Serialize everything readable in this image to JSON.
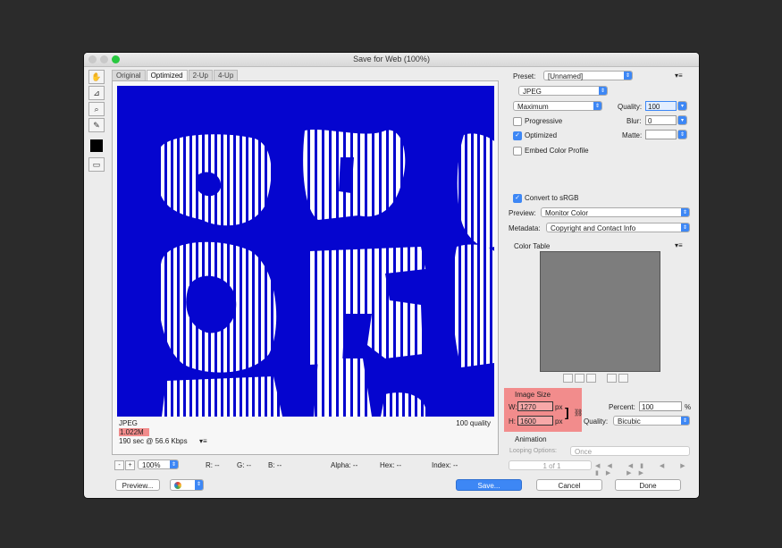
{
  "window": {
    "title": "Save for Web (100%)"
  },
  "tabs": [
    {
      "label": "Original"
    },
    {
      "label": "Optimized"
    },
    {
      "label": "2-Up"
    },
    {
      "label": "4-Up"
    }
  ],
  "tools": {
    "hand": "✋",
    "slice": "⊿",
    "zoom": "⌕",
    "eyedropper": "✎"
  },
  "image_info": {
    "format": "JPEG",
    "size": "1.022M",
    "time": "190 sec @ 56.6 Kbps",
    "quality": "100 quality"
  },
  "statusbar": {
    "zoom": "100%",
    "r": "R: --",
    "g": "G: --",
    "b": "B: --",
    "alpha": "Alpha: --",
    "hex": "Hex: --",
    "index": "Index: --"
  },
  "settings": {
    "preset_label": "Preset:",
    "preset_value": "[Unnamed]",
    "format": "JPEG",
    "compression": "Maximum",
    "quality_label": "Quality:",
    "quality_value": "100",
    "blur_label": "Blur:",
    "blur_value": "0",
    "matte_label": "Matte:",
    "progressive": "Progressive",
    "optimized": "Optimized",
    "embed_profile": "Embed Color Profile",
    "convert_srgb": "Convert to sRGB",
    "preview_label": "Preview:",
    "preview_value": "Monitor Color",
    "metadata_label": "Metadata:",
    "metadata_value": "Copyright and Contact Info",
    "color_table": "Color Table"
  },
  "image_size": {
    "title": "Image Size",
    "w_label": "W:",
    "w_value": "1270",
    "h_label": "H:",
    "h_value": "1600",
    "unit": "px",
    "percent_label": "Percent:",
    "percent_value": "100",
    "percent_unit": "%",
    "quality_label": "Quality:",
    "quality_value": "Bicubic"
  },
  "animation": {
    "title": "Animation",
    "looping_label": "Looping Options:",
    "looping_value": "Once",
    "frame": "1 of 1"
  },
  "buttons": {
    "preview": "Preview...",
    "save": "Save...",
    "cancel": "Cancel",
    "done": "Done"
  },
  "colors": {
    "canvas": "#0505cf",
    "accent": "#3d87f5",
    "highlight": "#f28c8c"
  }
}
